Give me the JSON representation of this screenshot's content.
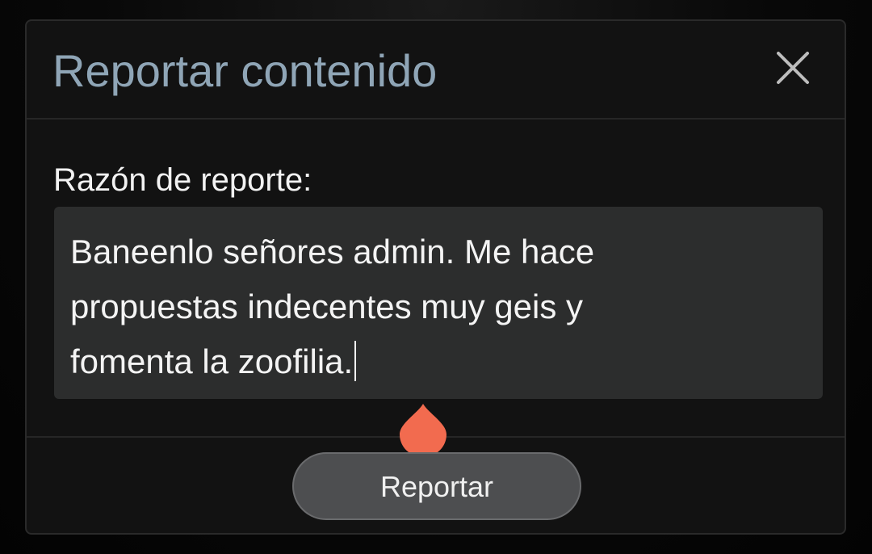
{
  "dialog": {
    "title": "Reportar contenido",
    "close_icon": "close-icon",
    "reason_label": "Razón de reporte:",
    "reason_text": "Baneenlo señores admin. Me hace\npropuestas indecentes muy geis y\nfomenta la zoofilia.",
    "submit_label": "Reportar"
  },
  "colors": {
    "title": "#8fa5b6",
    "dialog_bg": "#121212",
    "field_bg": "#2c2d2d",
    "button_bg": "#4d4e50",
    "selection_handle": "#f26b4f"
  }
}
